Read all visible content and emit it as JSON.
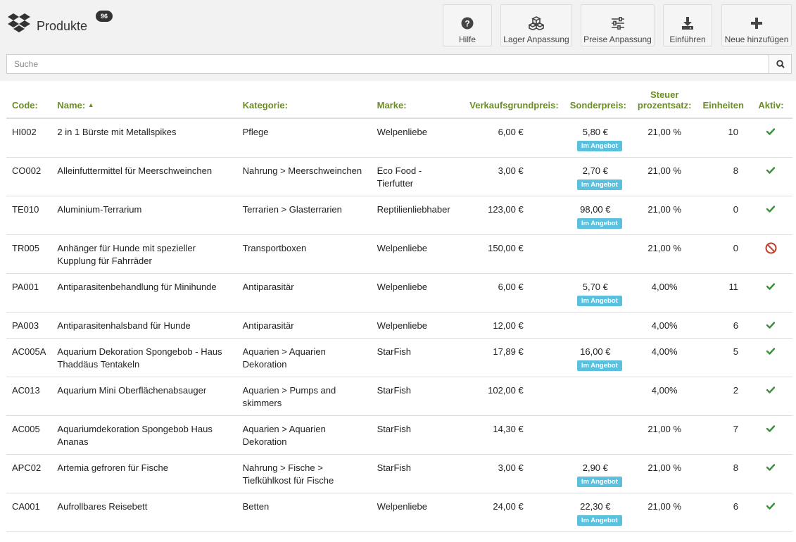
{
  "header": {
    "title": "Produkte",
    "count": "96"
  },
  "toolbar": [
    {
      "id": "hilfe",
      "label": "Hilfe",
      "icon": "help-icon"
    },
    {
      "id": "lager",
      "label": "Lager Anpassung",
      "icon": "boxes-icon"
    },
    {
      "id": "preise",
      "label": "Preise Anpassung",
      "icon": "sliders-icon"
    },
    {
      "id": "einfuehren",
      "label": "Einführen",
      "icon": "download-icon"
    },
    {
      "id": "neu",
      "label": "Neue hinzufügen",
      "icon": "plus-icon"
    }
  ],
  "search": {
    "placeholder": "Suche",
    "value": ""
  },
  "table": {
    "headers": {
      "code": "Code:",
      "name": "Name:",
      "category": "Kategorie:",
      "brand": "Marke:",
      "base_price": "Verkaufsgrundpreis:",
      "special_price": "Sonderpreis:",
      "tax_line1": "Steuer",
      "tax_line2": "prozentsatz:",
      "units": "Einheiten",
      "active": "Aktiv:"
    },
    "promo_label": "Im Angebot",
    "rows": [
      {
        "code": "HI002",
        "name": "2 in 1 Bürste mit Metallspikes",
        "category": "Pflege",
        "brand": "Welpenliebe",
        "base_price": "6,00 €",
        "special_price": "5,80 €",
        "on_offer": true,
        "tax": "21,00 %",
        "units": "10",
        "active": true
      },
      {
        "code": "CO002",
        "name": "Alleinfuttermittel für Meerschweinchen",
        "category": "Nahrung > Meerschweinchen",
        "brand": "Eco Food - Tierfutter",
        "base_price": "3,00 €",
        "special_price": "2,70 €",
        "on_offer": true,
        "tax": "21,00 %",
        "units": "8",
        "active": true
      },
      {
        "code": "TE010",
        "name": "Aluminium-Terrarium",
        "category": "Terrarien > Glasterrarien",
        "brand": "Reptilienliebhaber",
        "base_price": "123,00 €",
        "special_price": "98,00 €",
        "on_offer": true,
        "tax": "21,00 %",
        "units": "0",
        "active": true
      },
      {
        "code": "TR005",
        "name": "Anhänger für Hunde mit spezieller Kupplung für Fahrräder",
        "category": "Transportboxen",
        "brand": "Welpenliebe",
        "base_price": "150,00 €",
        "special_price": "",
        "on_offer": false,
        "tax": "21,00 %",
        "units": "0",
        "active": false
      },
      {
        "code": "PA001",
        "name": "Antiparasitenbehandlung für Minihunde",
        "category": "Antiparasitär",
        "brand": "Welpenliebe",
        "base_price": "6,00 €",
        "special_price": "5,70 €",
        "on_offer": true,
        "tax": "4,00%",
        "units": "11",
        "active": true
      },
      {
        "code": "PA003",
        "name": "Antiparasitenhalsband für Hunde",
        "category": "Antiparasitär",
        "brand": "Welpenliebe",
        "base_price": "12,00 €",
        "special_price": "",
        "on_offer": false,
        "tax": "4,00%",
        "units": "6",
        "active": true
      },
      {
        "code": "AC005A",
        "name": "Aquarium Dekoration Spongebob - Haus Thaddäus Tentakeln",
        "category": "Aquarien > Aquarien Dekoration",
        "brand": "StarFish",
        "base_price": "17,89 €",
        "special_price": "16,00 €",
        "on_offer": true,
        "tax": "4,00%",
        "units": "5",
        "active": true
      },
      {
        "code": "AC013",
        "name": "Aquarium Mini Oberflächenabsauger",
        "category": "Aquarien > Pumps and skimmers",
        "brand": "StarFish",
        "base_price": "102,00 €",
        "special_price": "",
        "on_offer": false,
        "tax": "4,00%",
        "units": "2",
        "active": true
      },
      {
        "code": "AC005",
        "name": "Aquariumdekoration Spongebob Haus Ananas",
        "category": "Aquarien > Aquarien Dekoration",
        "brand": "StarFish",
        "base_price": "14,30 €",
        "special_price": "",
        "on_offer": false,
        "tax": "21,00 %",
        "units": "7",
        "active": true
      },
      {
        "code": "APC02",
        "name": "Artemia gefroren für Fische",
        "category": "Nahrung > Fische > Tiefkühlkost für Fische",
        "brand": "StarFish",
        "base_price": "3,00 €",
        "special_price": "2,90 €",
        "on_offer": true,
        "tax": "21,00 %",
        "units": "8",
        "active": true
      },
      {
        "code": "CA001",
        "name": "Aufrollbares Reisebett",
        "category": "Betten",
        "brand": "Welpenliebe",
        "base_price": "24,00 €",
        "special_price": "22,30 €",
        "on_offer": true,
        "tax": "21,00 %",
        "units": "6",
        "active": true
      }
    ]
  },
  "colors": {
    "accent": "#6b8e23",
    "check": "#3c8d3c",
    "inactive": "#c0392b",
    "promo": "#5bc0de"
  }
}
